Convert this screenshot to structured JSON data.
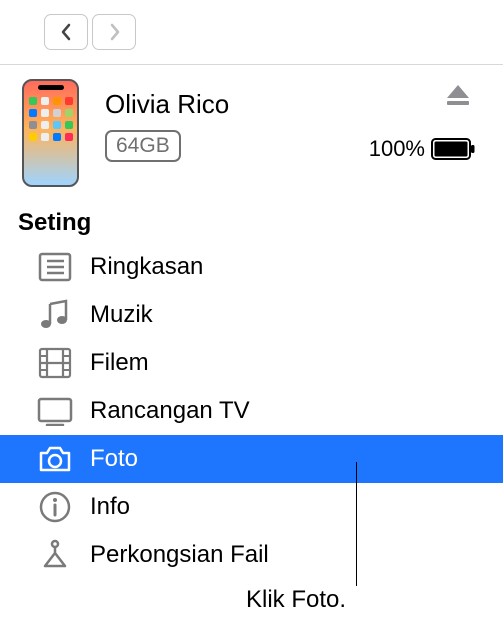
{
  "nav": {},
  "device": {
    "name": "Olivia Rico",
    "storage": "64GB",
    "battery_percent": "100%"
  },
  "section_title": "Seting",
  "sidebar": {
    "items": [
      {
        "label": "Ringkasan"
      },
      {
        "label": "Muzik"
      },
      {
        "label": "Filem"
      },
      {
        "label": "Rancangan TV"
      },
      {
        "label": "Foto"
      },
      {
        "label": "Info"
      },
      {
        "label": "Perkongsian Fail"
      }
    ]
  },
  "callout": "Klik Foto."
}
